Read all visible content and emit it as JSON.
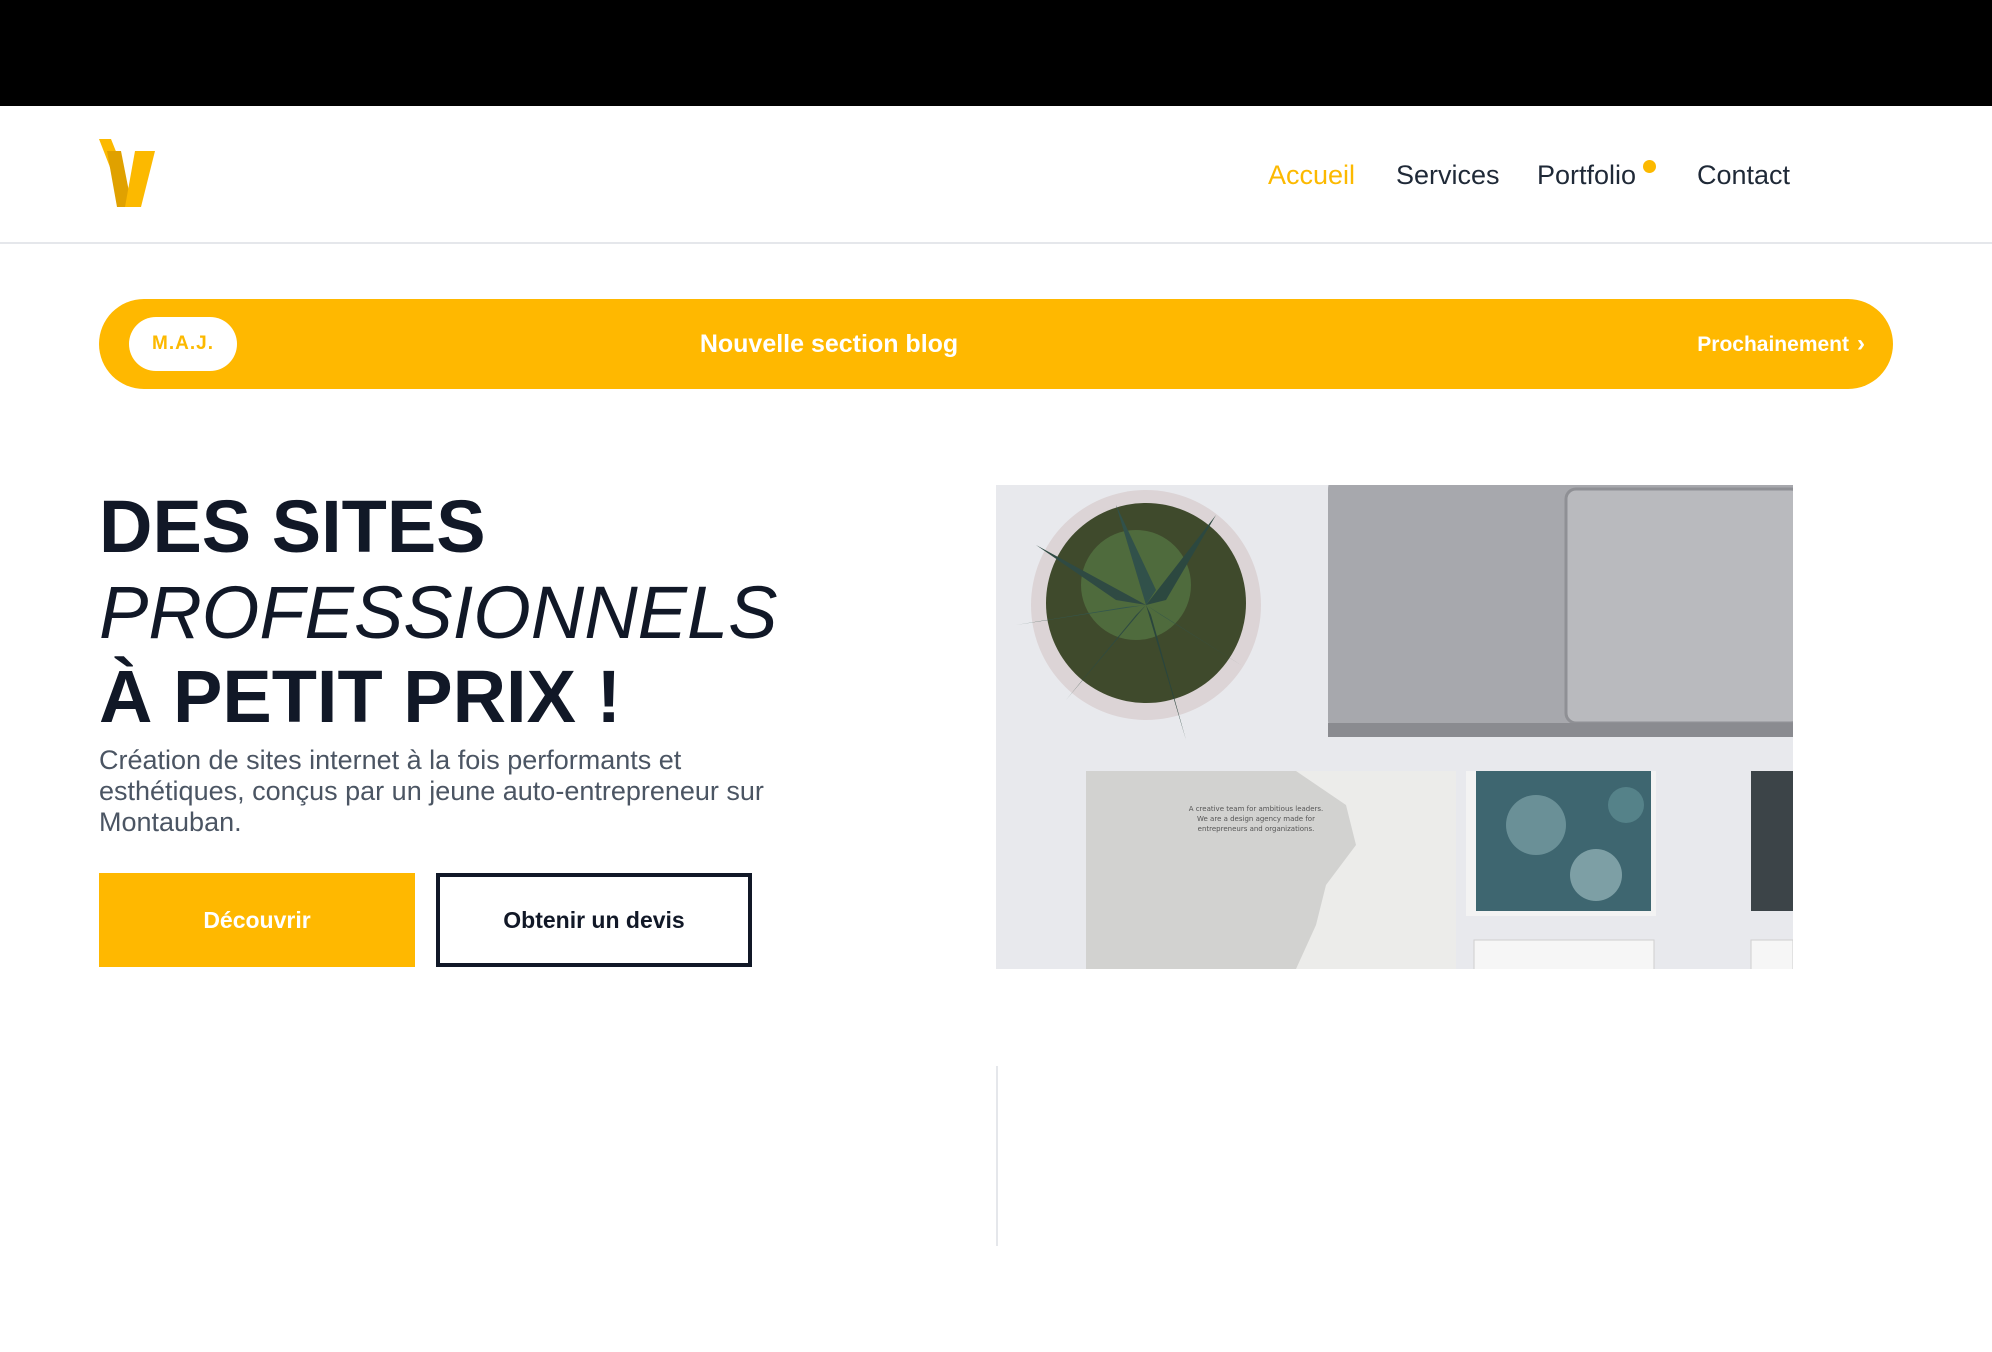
{
  "nav": {
    "items": [
      "Accueil",
      "Services",
      "Portfolio",
      "Contact"
    ],
    "active": "Accueil"
  },
  "banner": {
    "badge": "M.A.J.",
    "title": "Nouvelle section blog",
    "link": "Prochainement"
  },
  "hero": {
    "line1": "DES SITES",
    "line2": "PROFESSIONNELS",
    "line3": "À PETIT PRIX !",
    "description": "Création de sites internet à la fois performants et esthétiques, conçus par un jeune auto-entrepreneur sur Montauban.",
    "buttons": {
      "primary": "Découvrir",
      "secondary": "Obtenir un devis"
    }
  },
  "photo_card_text": "A creative team for ambitious leaders. We are a design agency made for entrepreneurs and organizations.",
  "colors": {
    "accent": "#FFB800",
    "text_dark": "#111827",
    "text_muted": "#4b5563"
  },
  "icons": [
    "logo-v-icon",
    "chevron-right-icon"
  ]
}
